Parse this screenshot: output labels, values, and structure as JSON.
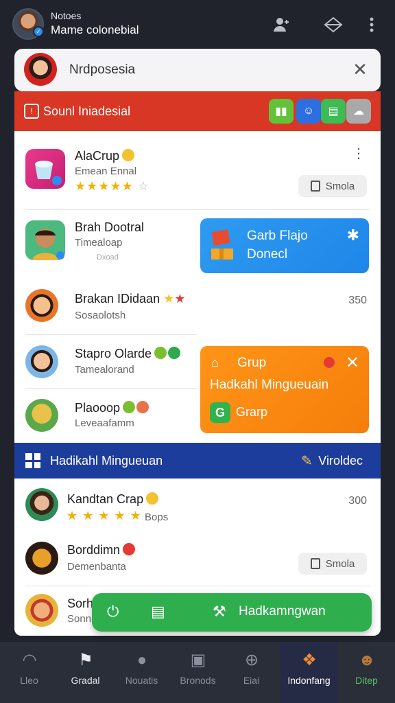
{
  "header": {
    "subtitle": "Notoes",
    "title": "Mame colonebial",
    "icons": [
      "add-user-icon",
      "diamond-icon",
      "more-vertical-icon"
    ]
  },
  "search": {
    "text": "Nrdposesia",
    "close": "✕"
  },
  "red_section": {
    "title": "Sounl Iniadesial",
    "apps": [
      {
        "color": "#62c33b",
        "glyph": "▮▮"
      },
      {
        "color": "#2d6fe0",
        "glyph": "☺"
      },
      {
        "color": "#3dbb55",
        "glyph": "▤"
      },
      {
        "color": "#a9a9a9",
        "glyph": "☁"
      }
    ]
  },
  "rows": [
    {
      "title": "AlaCrup",
      "sub": "Emean Ennal",
      "stars": "★★★★★",
      "stars_off": "☆",
      "pill": "Smola"
    },
    {
      "title": "Brah Dootral",
      "sub": "Timealoap",
      "sub2": "Dxoad"
    },
    {
      "title": "Brakan IDidaan",
      "sub": "Sosaolotsh",
      "num": "350"
    },
    {
      "title": "Stapro Olarde",
      "sub": "Tamealorand"
    },
    {
      "title": "Plaooop",
      "sub": "Leveaafamm"
    }
  ],
  "blue_card": {
    "line1": "Garb Flajo",
    "line2": "Donecl",
    "close": "✱"
  },
  "orange_card": {
    "title": "Grup",
    "body": "Hadkahl Mingueuain",
    "action": "Grarp",
    "g": "G",
    "close": "✕"
  },
  "blue_bar": {
    "title": "Hadikahl Mingueuan",
    "right": "Viroldec"
  },
  "rows2": [
    {
      "title": "Kandtan Crap",
      "stars": "★ ★ ★ ★ ★",
      "sub": "Bops",
      "num": "300"
    },
    {
      "title": "Borddimn",
      "sub": "Demenbanta",
      "pill": "Smola"
    },
    {
      "title": "Sorh",
      "sub": "Sonn"
    }
  ],
  "green_bar": {
    "label": "Hadkamngwan"
  },
  "nav": [
    {
      "label": "Lleo",
      "icon": "headphones-icon",
      "glyph": "◠"
    },
    {
      "label": "Gradal",
      "icon": "flag-icon",
      "glyph": "⚑"
    },
    {
      "label": "Nouatis",
      "icon": "chat-icon",
      "glyph": "●"
    },
    {
      "label": "Bronods",
      "icon": "book-icon",
      "glyph": "▣"
    },
    {
      "label": "Eiai",
      "icon": "download-icon",
      "glyph": "⊕"
    },
    {
      "label": "Indonfang",
      "icon": "gift-icon",
      "glyph": "❖"
    },
    {
      "label": "Ditep",
      "icon": "face-icon",
      "glyph": "☻"
    }
  ],
  "colors": {
    "background": "#20232c",
    "red": "#d93725",
    "blue": "#1d3d9c",
    "accent_blue": "#2e9bf0",
    "orange": "#ff9418",
    "green": "#2fae4e"
  }
}
